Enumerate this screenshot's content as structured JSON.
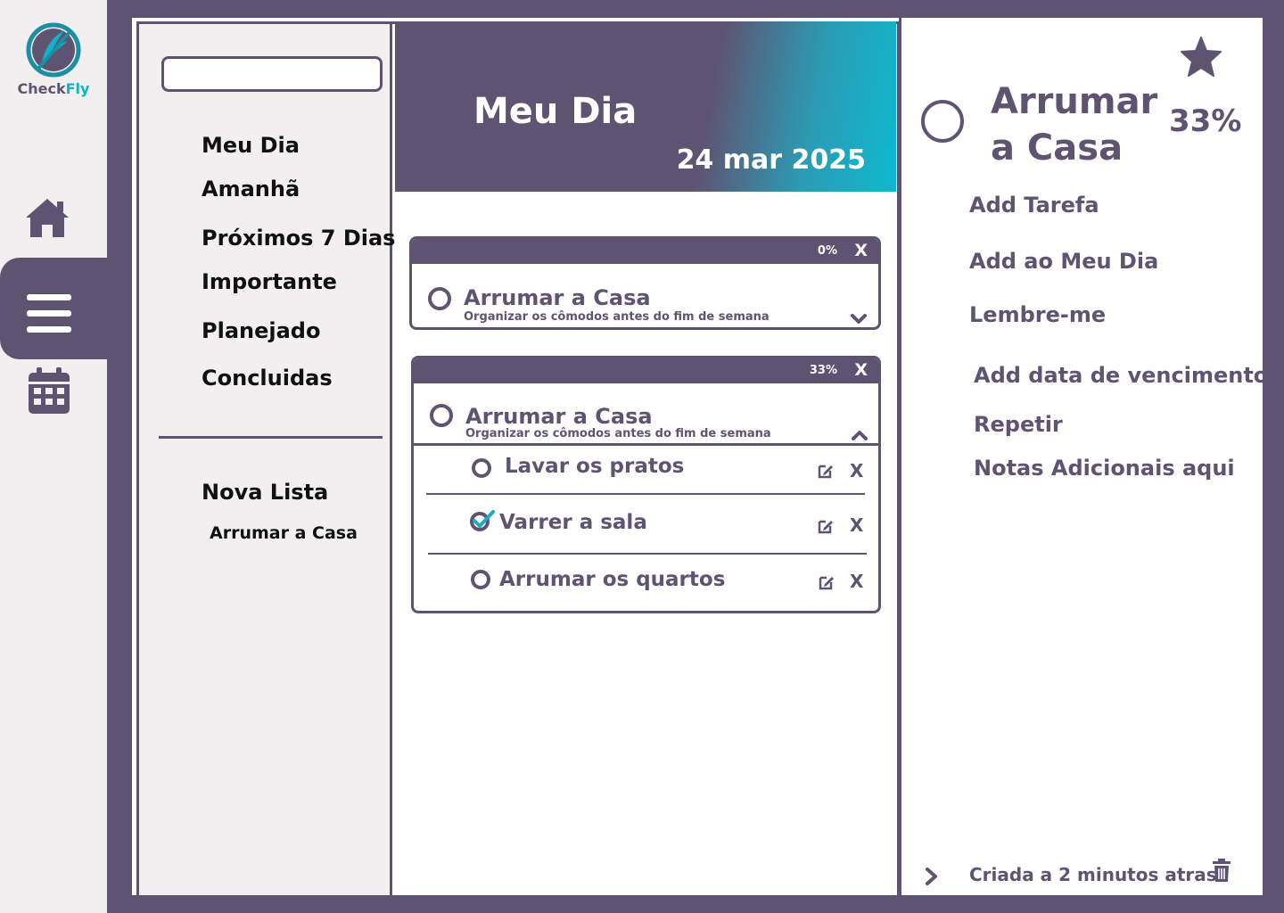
{
  "app": {
    "logo_text_check": "Check",
    "logo_text_fly": "Fly"
  },
  "rail": {
    "items": [
      {
        "icon": "home-icon"
      },
      {
        "icon": "menu-icon",
        "active": true
      },
      {
        "icon": "calendar-icon"
      }
    ]
  },
  "sidebar": {
    "search_placeholder": "",
    "items": [
      {
        "label": "Meu Dia"
      },
      {
        "label": "Amanhã"
      },
      {
        "label": "Próximos 7 Dias"
      },
      {
        "label": "Importante"
      },
      {
        "label": "Planejado"
      },
      {
        "label": "Concluidas"
      }
    ],
    "new_list_label": "Nova Lista",
    "lists": [
      {
        "label": "Arrumar a Casa"
      }
    ]
  },
  "main": {
    "title": "Meu Dia",
    "date": "24 mar 2025",
    "cards": [
      {
        "progress_label": "0%",
        "close": "X",
        "title": "Arrumar a Casa",
        "subtitle": "Organizar os cômodos antes do fim de semana",
        "expanded": false
      },
      {
        "progress_label": "33%",
        "close": "X",
        "title": "Arrumar a Casa",
        "subtitle": "Organizar os cômodos antes do fim de semana",
        "expanded": true,
        "subtasks": [
          {
            "label": "Lavar os pratos",
            "done": false,
            "delete": "X"
          },
          {
            "label": "Varrer a sala",
            "done": true,
            "delete": "X"
          },
          {
            "label": "Arrumar os quartos",
            "done": false,
            "delete": "X"
          }
        ]
      }
    ]
  },
  "detail": {
    "title": "Arrumar a Casa",
    "progress": "33%",
    "options": [
      {
        "label": "Add Tarefa"
      },
      {
        "label": "Add ao Meu Dia"
      },
      {
        "label": "Lembre-me"
      },
      {
        "label": "Add data de vencimento"
      },
      {
        "label": "Repetir"
      },
      {
        "label": "Notas Adicionais aqui"
      }
    ],
    "created": "Criada a 2 minutos atras"
  },
  "colors": {
    "primary": "#5e5472",
    "accent": "#0eb4c9",
    "surface": "#f1eff0",
    "check": "#1fa9c4"
  }
}
